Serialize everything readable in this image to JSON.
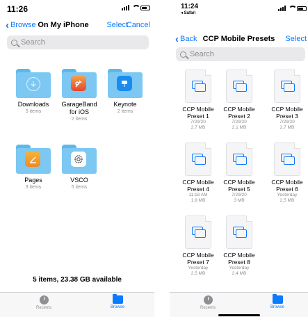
{
  "left": {
    "time": "11:26",
    "nav": {
      "back": "Browse",
      "title": "On My iPhone",
      "select": "Select",
      "cancel": "Cancel"
    },
    "search_placeholder": "Search",
    "folders": [
      {
        "name": "Downloads",
        "meta": "5 items",
        "icon": "download-icon"
      },
      {
        "name": "GarageBand for iOS",
        "meta": "2 items",
        "icon": "garageband-app-icon"
      },
      {
        "name": "Keynote",
        "meta": "2 items",
        "icon": "keynote-app-icon"
      },
      {
        "name": "Pages",
        "meta": "3 items",
        "icon": "pages-app-icon"
      },
      {
        "name": "VSCO",
        "meta": "5 items",
        "icon": "vsco-app-icon"
      }
    ],
    "storage": "5 items, 23.38 GB available",
    "tabs": {
      "recents": "Recents",
      "browse": "Browse"
    }
  },
  "right": {
    "time": "11:24",
    "back_app": "◂ Safari",
    "nav": {
      "back": "Back",
      "title": "CCP Mobile Presets",
      "select": "Select"
    },
    "search_placeholder": "Search",
    "files": [
      {
        "name": "CCP Mobile Preset 1",
        "date": "7/29/20",
        "size": "2.7 MB"
      },
      {
        "name": "CCP Mobile Preset 2",
        "date": "7/29/20",
        "size": "2.1 MB"
      },
      {
        "name": "CCP Mobile Preset 3",
        "date": "7/29/20",
        "size": "2.7 MB"
      },
      {
        "name": "CCP Mobile Preset 4",
        "date": "11:18 AM",
        "size": "1.9 MB"
      },
      {
        "name": "CCP Mobile Preset 5",
        "date": "7/29/20",
        "size": "3 MB"
      },
      {
        "name": "CCP Mobile Preset 6",
        "date": "Yesterday",
        "size": "2.5 MB"
      },
      {
        "name": "CCP Mobile Preset 7",
        "date": "Yesterday",
        "size": "2.5 MB"
      },
      {
        "name": "CCP Mobile Preset 8",
        "date": "Yesterday",
        "size": "2.4 MB"
      }
    ],
    "tabs": {
      "recents": "Recents",
      "browse": "Browse"
    }
  },
  "colors": {
    "accent": "#0a7aff",
    "folder": "#7cc8f3",
    "secondary_text": "#8e8e93"
  }
}
